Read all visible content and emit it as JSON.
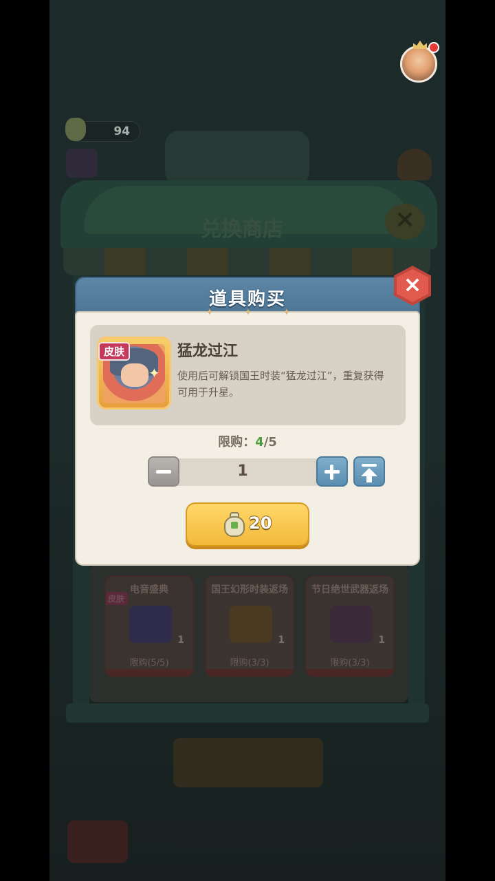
{
  "background": {
    "currency_value": "94",
    "shop_title": "兑换商店",
    "cards": [
      {
        "title": "电音盛典",
        "count": "1",
        "limit": "限购(5/5)",
        "skin": "皮肤"
      },
      {
        "title": "国王幻形时装返场",
        "count": "1",
        "limit": "限购(3/3)"
      },
      {
        "title": "节日绝世武器返场",
        "count": "1",
        "limit": "限购(3/3)"
      }
    ]
  },
  "modal": {
    "title": "道具购买",
    "close": "×",
    "item": {
      "tag": "皮肤",
      "name": "猛龙过江",
      "description": "使用后可解锁国王时装“猛龙过江”，重复获得可用于升星。"
    },
    "limit_label": "限购：",
    "limit_current": "4",
    "limit_total": "/5",
    "quantity": "1",
    "price": "20"
  },
  "icons": {
    "avatar": "king-avatar-icon",
    "minus": "minus-icon",
    "plus": "plus-icon",
    "max": "max-arrow-icon",
    "currency": "money-bag-icon"
  },
  "colors": {
    "header": "#5d85a6",
    "body": "#f4efe4",
    "buy_button": "#f2b93a",
    "close": "#e25a4e",
    "limit_current": "#4c9a3e"
  }
}
